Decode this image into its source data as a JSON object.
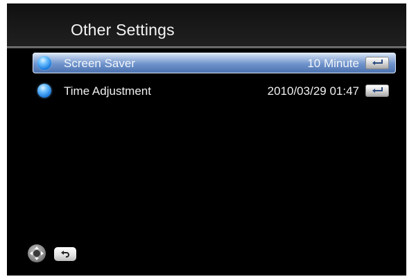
{
  "header": {
    "title": "Other Settings"
  },
  "menu": {
    "items": [
      {
        "label": "Screen Saver",
        "value": "10 Minute",
        "selected": true,
        "icon": "enter-icon"
      },
      {
        "label": "Time Adjustment",
        "value": "2010/03/29 01:47",
        "selected": false,
        "icon": "enter-icon"
      }
    ]
  },
  "footer": {
    "icons": [
      "dpad-icon",
      "back-icon"
    ]
  },
  "colors": {
    "background": "#000000",
    "highlight": "#6f93cb",
    "bullet": "#1f7fe0",
    "text": "#f0f0f0"
  }
}
